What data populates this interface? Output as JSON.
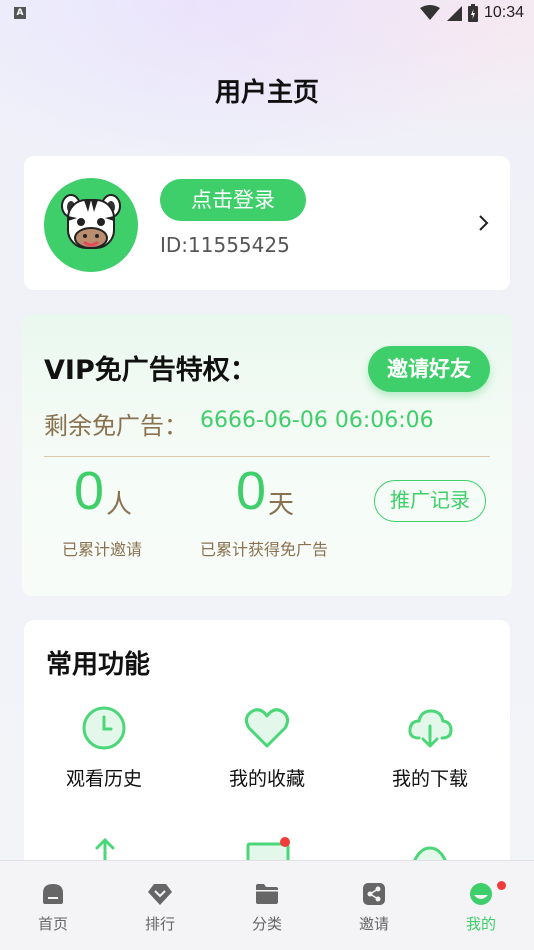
{
  "status_bar": {
    "app_indicator": "A",
    "time": "10:34"
  },
  "header": {
    "title": "用户主页"
  },
  "user": {
    "login_label": "点击登录",
    "id_text": "ID:11555425"
  },
  "vip": {
    "title": "VIP免广告特权：",
    "invite_label": "邀请好友",
    "remaining_label": "剩余免广告：",
    "remaining_value": "6666-06-06 06:06:06",
    "invited_count": "0",
    "invited_unit": "人",
    "invited_caption": "已累计邀请",
    "days_count": "0",
    "days_unit": "天",
    "days_caption": "已累计获得免广告",
    "promo_label": "推广记录"
  },
  "functions": {
    "title": "常用功能",
    "items": [
      {
        "label": "观看历史",
        "icon": "clock-icon"
      },
      {
        "label": "我的收藏",
        "icon": "heart-icon"
      },
      {
        "label": "我的下载",
        "icon": "cloud-download-icon"
      }
    ]
  },
  "nav": {
    "items": [
      {
        "label": "首页",
        "icon": "home-icon"
      },
      {
        "label": "排行",
        "icon": "diamond-icon"
      },
      {
        "label": "分类",
        "icon": "folder-icon"
      },
      {
        "label": "邀请",
        "icon": "share-icon"
      },
      {
        "label": "我的",
        "icon": "profile-icon"
      }
    ],
    "active_index": 4
  },
  "colors": {
    "accent": "#3ecf6a",
    "gold": "#8a7250",
    "badge": "#f23b3b"
  }
}
